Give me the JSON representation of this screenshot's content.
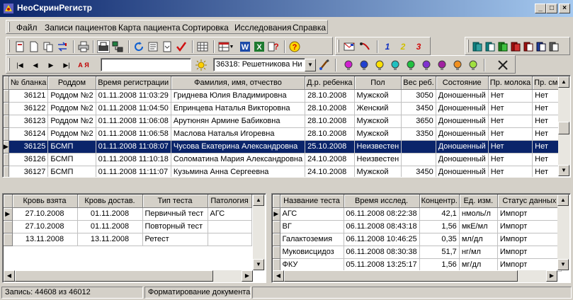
{
  "window": {
    "title": "НеоСкринРегистр",
    "min": "_",
    "max": "□",
    "close": "×"
  },
  "menu": [
    "Файл",
    "Записи пациентов",
    "Карта пациента",
    "Сортировка",
    "Исследования",
    "Справка"
  ],
  "toolbar": {
    "search_value": "",
    "patient_combo": "36318: Решетникова Ни",
    "numbers": [
      "1",
      "2",
      "3"
    ],
    "sort_label": "А Я"
  },
  "colors": {
    "selection": "#0a246a",
    "face": "#d4d0c8",
    "title_start": "#0a246a",
    "title_end": "#a6caf0"
  },
  "patients": {
    "columns": [
      "№ бланка",
      "Роддом",
      "Время регистрации",
      "Фамилия, имя, отчество",
      "Д.р. ребенка",
      "Пол",
      "Вес реб.",
      "Состояние",
      "Пр. молока",
      "Пр. смеси"
    ],
    "rows": [
      [
        "36121",
        "Роддом №2",
        "01.11.2008 11:03:29",
        "Гриднева Юлия Владимировна",
        "28.10.2008",
        "Мужской",
        "3050",
        "Доношенный",
        "Нет",
        "Нет"
      ],
      [
        "36122",
        "Роддом №2",
        "01.11.2008 11:04:50",
        "Епринцева Наталья Викторовна",
        "28.10.2008",
        "Женский",
        "3450",
        "Доношенный",
        "Нет",
        "Нет"
      ],
      [
        "36123",
        "Роддом №2",
        "01.11.2008 11:06:08",
        "Арутюнян Армине Бабиковна",
        "28.10.2008",
        "Мужской",
        "3650",
        "Доношенный",
        "Нет",
        "Нет"
      ],
      [
        "36124",
        "Роддом №2",
        "01.11.2008 11:06:58",
        "Маслова Наталья Игоревна",
        "28.10.2008",
        "Мужской",
        "3350",
        "Доношенный",
        "Нет",
        "Нет"
      ],
      [
        "36125",
        "БСМП",
        "01.11.2008 11:08:07",
        "Чусова Екатерина Александровна",
        "25.10.2008",
        "Неизвестен",
        "",
        "Доношенный",
        "Нет",
        "Нет"
      ],
      [
        "36126",
        "БСМП",
        "01.11.2008 11:10:18",
        "Соломатина Мария Александровна",
        "24.10.2008",
        "Неизвестен",
        "",
        "Доношенный",
        "Нет",
        "Нет"
      ],
      [
        "36127",
        "БСМП",
        "01.11.2008 11:11:07",
        "Кузьмина Анна Сергеевна",
        "24.10.2008",
        "Мужской",
        "3450",
        "Доношенный",
        "Нет",
        "Нет"
      ]
    ],
    "selected_row": 4
  },
  "tests": {
    "columns": [
      "Кровь взята",
      "Кровь достав.",
      "Тип теста",
      "Патология"
    ],
    "rows": [
      [
        "27.10.2008",
        "01.11.2008",
        "Первичный тест",
        "АГС"
      ],
      [
        "27.10.2008",
        "01.11.2008",
        "Повторный тест",
        ""
      ],
      [
        "13.11.2008",
        "13.11.2008",
        "Ретест",
        ""
      ]
    ]
  },
  "results": {
    "columns": [
      "Название теста",
      "Время исслед.",
      "Концентр.",
      "Ед. изм.",
      "Статус данных"
    ],
    "rows": [
      [
        "АГС",
        "06.11.2008 08:22:38",
        "42,1",
        "нмоль/л",
        "Импорт"
      ],
      [
        "ВГ",
        "06.11.2008 08:43:18",
        "1,56",
        "мкЕ/мл",
        "Импорт"
      ],
      [
        "Галактоземия",
        "06.11.2008 10:46:25",
        "0,35",
        "мл/дл",
        "Импорт"
      ],
      [
        "Муковисцидоз",
        "06.11.2008 08:30:38",
        "51,7",
        "нг/мл",
        "Импорт"
      ],
      [
        "ФКУ",
        "05.11.2008 13:25:17",
        "1,56",
        "мг/дл",
        "Импорт"
      ]
    ]
  },
  "status": {
    "record": "Запись: 44608 из 46012",
    "message": "Форматирование документа"
  }
}
